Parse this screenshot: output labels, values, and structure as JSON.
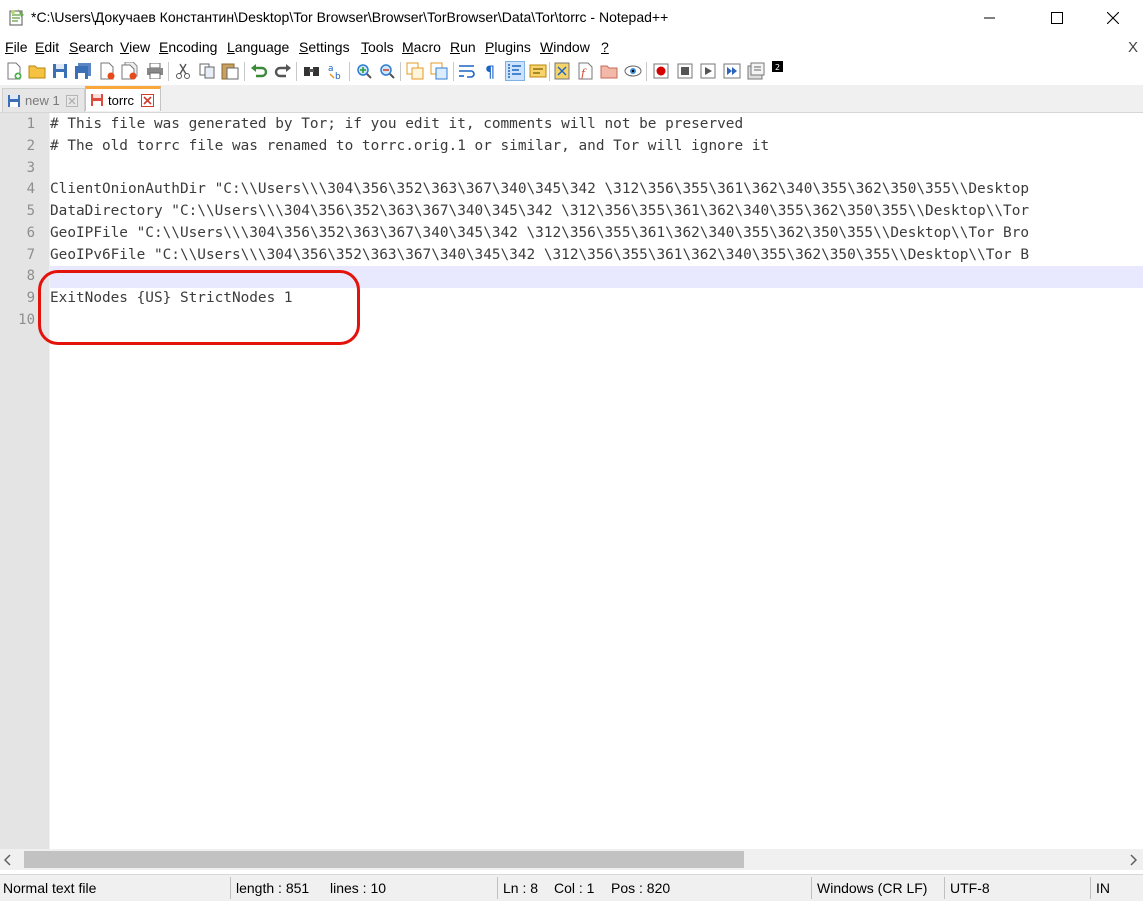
{
  "window": {
    "title": "*C:\\Users\\Докучаев Константин\\Desktop\\Tor Browser\\Browser\\TorBrowser\\Data\\Tor\\torrc - Notepad++",
    "icon": "notepadpp-icon",
    "controls": [
      "minimize-icon",
      "maximize-icon",
      "close-icon"
    ]
  },
  "menu": {
    "items": [
      {
        "label": "File",
        "u": "F",
        "rest": "ile"
      },
      {
        "label": "Edit",
        "u": "E",
        "rest": "dit"
      },
      {
        "label": "Search",
        "u": "S",
        "rest": "earch"
      },
      {
        "label": "View",
        "u": "V",
        "rest": "iew"
      },
      {
        "label": "Encoding",
        "u": "E",
        "rest": "ncoding"
      },
      {
        "label": "Language",
        "u": "L",
        "rest": "anguage"
      },
      {
        "label": "Settings",
        "u": "S",
        "rest": "ettings"
      },
      {
        "label": "Tools",
        "u": "T",
        "rest": "ools"
      },
      {
        "label": "Macro",
        "u": "M",
        "rest": "acro"
      },
      {
        "label": "Run",
        "u": "R",
        "rest": "un"
      },
      {
        "label": "Plugins",
        "u": "P",
        "rest": "lugins"
      },
      {
        "label": "Window",
        "u": "W",
        "rest": "indow"
      },
      {
        "label": "?",
        "u": "?",
        "rest": ""
      }
    ],
    "close": "X"
  },
  "toolbar": {
    "buttons": [
      "new-file-icon",
      "open-file-icon",
      "save-icon",
      "save-all-icon",
      "close-icon",
      "close-all-icon",
      "print-icon",
      "cut-icon",
      "copy-icon",
      "paste-icon",
      "undo-icon",
      "redo-icon",
      "find-icon",
      "replace-icon",
      "zoom-in-icon",
      "zoom-out-icon",
      "sync-vertical-icon",
      "sync-horizontal-icon",
      "word-wrap-icon",
      "show-all-chars-icon",
      "indent-guide-icon",
      "udl-icon",
      "doc-map-icon",
      "function-list-icon",
      "folder-workspace-icon",
      "monitoring-icon",
      "record-macro-icon",
      "stop-record-icon",
      "play-macro-icon",
      "run-macro-multiple-icon",
      "save-macro-icon",
      "plugin-icon"
    ]
  },
  "tabs": [
    {
      "label": "new 1",
      "active": false
    },
    {
      "label": "torrc",
      "active": true
    }
  ],
  "editor": {
    "lines": [
      "# This file was generated by Tor; if you edit it, comments will not be preserved",
      "# The old torrc file was renamed to torrc.orig.1 or similar, and Tor will ignore it",
      "",
      "ClientOnionAuthDir \"C:\\\\Users\\\\\\304\\356\\352\\363\\367\\340\\345\\342 \\312\\356\\355\\361\\362\\340\\355\\362\\350\\355\\\\Desktop",
      "DataDirectory \"C:\\\\Users\\\\\\304\\356\\352\\363\\367\\340\\345\\342 \\312\\356\\355\\361\\362\\340\\355\\362\\350\\355\\\\Desktop\\\\Tor",
      "GeoIPFile \"C:\\\\Users\\\\\\304\\356\\352\\363\\367\\340\\345\\342 \\312\\356\\355\\361\\362\\340\\355\\362\\350\\355\\\\Desktop\\\\Tor Bro",
      "GeoIPv6File \"C:\\\\Users\\\\\\304\\356\\352\\363\\367\\340\\345\\342 \\312\\356\\355\\361\\362\\340\\355\\362\\350\\355\\\\Desktop\\\\Tor B",
      "",
      "ExitNodes {US} StrictNodes 1",
      ""
    ],
    "line_numbers": [
      "1",
      "2",
      "3",
      "4",
      "5",
      "6",
      "7",
      "8",
      "9",
      "10"
    ],
    "current_line": 8,
    "highlight_color": "#e3120b"
  },
  "status": {
    "file_type": "Normal text file",
    "length": "length : 851",
    "lines": "lines : 10",
    "ln": "Ln : 8",
    "col": "Col : 1",
    "pos": "Pos : 820",
    "eol": "Windows (CR LF)",
    "encoding": "UTF-8",
    "mode": "IN"
  }
}
